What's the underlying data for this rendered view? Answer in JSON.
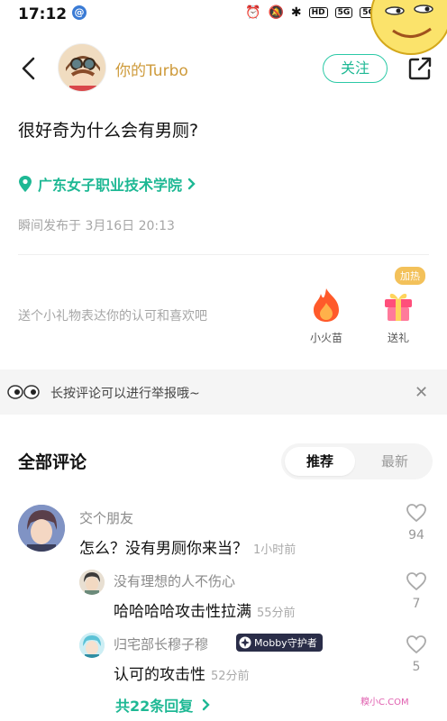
{
  "status_bar": {
    "time": "17:12",
    "app_icon": "@",
    "network_labels": [
      "HD",
      "5G",
      "5G"
    ]
  },
  "header": {
    "username": "你的Turbo",
    "follow_label": "关注"
  },
  "post": {
    "text": "很好奇为什么会有男厕?",
    "location": "广东女子职业技术学院",
    "publish_time": "瞬间发布于 3月16日 20:13"
  },
  "gifts": {
    "hint": "送个小礼物表达你的认可和喜欢吧",
    "fire_label": "小火苗",
    "send_label": "送礼",
    "boost_badge": "加热"
  },
  "report_bar": {
    "text": "长按评论可以进行举报哦~"
  },
  "comments_section": {
    "title": "全部评论",
    "sort_recommend": "推荐",
    "sort_latest": "最新"
  },
  "comments": [
    {
      "name": "交个朋友",
      "text": "怎么？没有男厕你来当？",
      "time": "1小时前",
      "likes": "94"
    },
    {
      "name": "没有理想的人不伤心",
      "text": "哈哈哈哈攻击性拉满",
      "time": "55分前",
      "likes": "7"
    },
    {
      "name": "归宅部长穆子穆",
      "badge": "Mobby守护者",
      "text": "认可的攻击性",
      "time": "52分前",
      "likes": "5"
    }
  ],
  "replies_link": "共22条回复",
  "watermark": "糗小C.COM",
  "colors": {
    "accent": "#1eb894",
    "username": "#ce9a3a",
    "fire": "#ff5a2a",
    "gift": "#ff4f7b",
    "boost": "#f3c15a"
  },
  "icons": [
    "back-arrow-icon",
    "share-icon",
    "location-pin-icon",
    "chevron-right-icon",
    "fire-icon",
    "gift-icon",
    "eyes-icon",
    "close-icon",
    "heart-icon",
    "guardian-badge-icon"
  ]
}
